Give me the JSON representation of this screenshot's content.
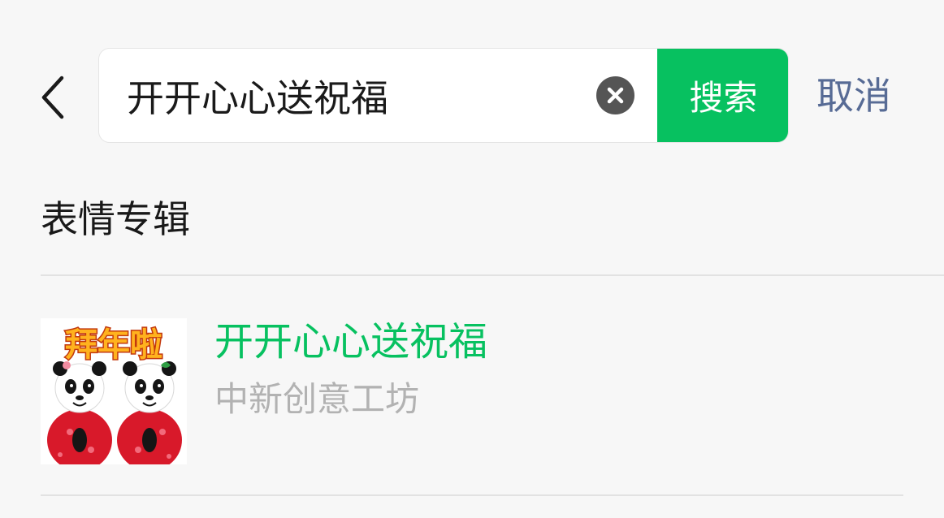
{
  "search": {
    "query": "开开心心送祝福",
    "button_label": "搜索",
    "cancel_label": "取消"
  },
  "section": {
    "title": "表情专辑"
  },
  "results": [
    {
      "title": "开开心心送祝福",
      "author": "中新创意工坊",
      "cover_text": "拜年啦"
    }
  ],
  "colors": {
    "accent": "#07c160",
    "link": "#576b95",
    "secondary_text": "#b2b2b2",
    "background": "#f7f7f7"
  },
  "icons": {
    "back": "chevron-left-icon",
    "clear": "clear-circle-icon"
  }
}
